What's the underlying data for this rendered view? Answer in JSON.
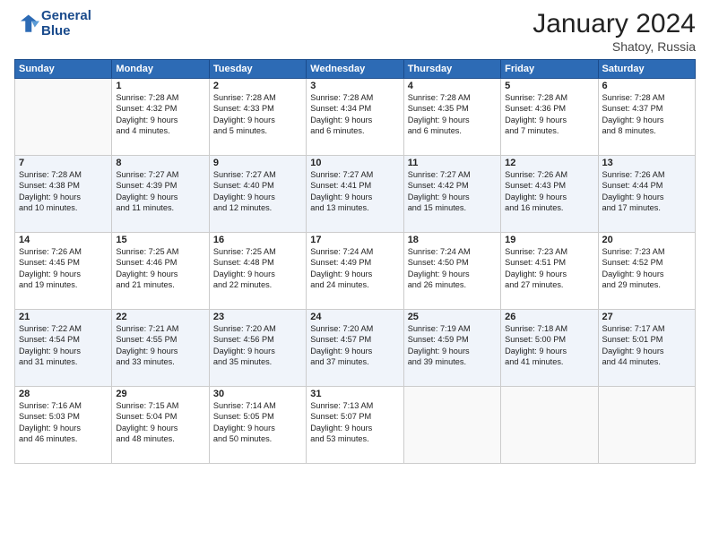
{
  "logo": {
    "line1": "General",
    "line2": "Blue"
  },
  "title": "January 2024",
  "location": "Shatoy, Russia",
  "days_of_week": [
    "Sunday",
    "Monday",
    "Tuesday",
    "Wednesday",
    "Thursday",
    "Friday",
    "Saturday"
  ],
  "weeks": [
    [
      {
        "num": "",
        "info": ""
      },
      {
        "num": "1",
        "info": "Sunrise: 7:28 AM\nSunset: 4:32 PM\nDaylight: 9 hours\nand 4 minutes."
      },
      {
        "num": "2",
        "info": "Sunrise: 7:28 AM\nSunset: 4:33 PM\nDaylight: 9 hours\nand 5 minutes."
      },
      {
        "num": "3",
        "info": "Sunrise: 7:28 AM\nSunset: 4:34 PM\nDaylight: 9 hours\nand 6 minutes."
      },
      {
        "num": "4",
        "info": "Sunrise: 7:28 AM\nSunset: 4:35 PM\nDaylight: 9 hours\nand 6 minutes."
      },
      {
        "num": "5",
        "info": "Sunrise: 7:28 AM\nSunset: 4:36 PM\nDaylight: 9 hours\nand 7 minutes."
      },
      {
        "num": "6",
        "info": "Sunrise: 7:28 AM\nSunset: 4:37 PM\nDaylight: 9 hours\nand 8 minutes."
      }
    ],
    [
      {
        "num": "7",
        "info": "Sunrise: 7:28 AM\nSunset: 4:38 PM\nDaylight: 9 hours\nand 10 minutes."
      },
      {
        "num": "8",
        "info": "Sunrise: 7:27 AM\nSunset: 4:39 PM\nDaylight: 9 hours\nand 11 minutes."
      },
      {
        "num": "9",
        "info": "Sunrise: 7:27 AM\nSunset: 4:40 PM\nDaylight: 9 hours\nand 12 minutes."
      },
      {
        "num": "10",
        "info": "Sunrise: 7:27 AM\nSunset: 4:41 PM\nDaylight: 9 hours\nand 13 minutes."
      },
      {
        "num": "11",
        "info": "Sunrise: 7:27 AM\nSunset: 4:42 PM\nDaylight: 9 hours\nand 15 minutes."
      },
      {
        "num": "12",
        "info": "Sunrise: 7:26 AM\nSunset: 4:43 PM\nDaylight: 9 hours\nand 16 minutes."
      },
      {
        "num": "13",
        "info": "Sunrise: 7:26 AM\nSunset: 4:44 PM\nDaylight: 9 hours\nand 17 minutes."
      }
    ],
    [
      {
        "num": "14",
        "info": "Sunrise: 7:26 AM\nSunset: 4:45 PM\nDaylight: 9 hours\nand 19 minutes."
      },
      {
        "num": "15",
        "info": "Sunrise: 7:25 AM\nSunset: 4:46 PM\nDaylight: 9 hours\nand 21 minutes."
      },
      {
        "num": "16",
        "info": "Sunrise: 7:25 AM\nSunset: 4:48 PM\nDaylight: 9 hours\nand 22 minutes."
      },
      {
        "num": "17",
        "info": "Sunrise: 7:24 AM\nSunset: 4:49 PM\nDaylight: 9 hours\nand 24 minutes."
      },
      {
        "num": "18",
        "info": "Sunrise: 7:24 AM\nSunset: 4:50 PM\nDaylight: 9 hours\nand 26 minutes."
      },
      {
        "num": "19",
        "info": "Sunrise: 7:23 AM\nSunset: 4:51 PM\nDaylight: 9 hours\nand 27 minutes."
      },
      {
        "num": "20",
        "info": "Sunrise: 7:23 AM\nSunset: 4:52 PM\nDaylight: 9 hours\nand 29 minutes."
      }
    ],
    [
      {
        "num": "21",
        "info": "Sunrise: 7:22 AM\nSunset: 4:54 PM\nDaylight: 9 hours\nand 31 minutes."
      },
      {
        "num": "22",
        "info": "Sunrise: 7:21 AM\nSunset: 4:55 PM\nDaylight: 9 hours\nand 33 minutes."
      },
      {
        "num": "23",
        "info": "Sunrise: 7:20 AM\nSunset: 4:56 PM\nDaylight: 9 hours\nand 35 minutes."
      },
      {
        "num": "24",
        "info": "Sunrise: 7:20 AM\nSunset: 4:57 PM\nDaylight: 9 hours\nand 37 minutes."
      },
      {
        "num": "25",
        "info": "Sunrise: 7:19 AM\nSunset: 4:59 PM\nDaylight: 9 hours\nand 39 minutes."
      },
      {
        "num": "26",
        "info": "Sunrise: 7:18 AM\nSunset: 5:00 PM\nDaylight: 9 hours\nand 41 minutes."
      },
      {
        "num": "27",
        "info": "Sunrise: 7:17 AM\nSunset: 5:01 PM\nDaylight: 9 hours\nand 44 minutes."
      }
    ],
    [
      {
        "num": "28",
        "info": "Sunrise: 7:16 AM\nSunset: 5:03 PM\nDaylight: 9 hours\nand 46 minutes."
      },
      {
        "num": "29",
        "info": "Sunrise: 7:15 AM\nSunset: 5:04 PM\nDaylight: 9 hours\nand 48 minutes."
      },
      {
        "num": "30",
        "info": "Sunrise: 7:14 AM\nSunset: 5:05 PM\nDaylight: 9 hours\nand 50 minutes."
      },
      {
        "num": "31",
        "info": "Sunrise: 7:13 AM\nSunset: 5:07 PM\nDaylight: 9 hours\nand 53 minutes."
      },
      {
        "num": "",
        "info": ""
      },
      {
        "num": "",
        "info": ""
      },
      {
        "num": "",
        "info": ""
      }
    ]
  ]
}
